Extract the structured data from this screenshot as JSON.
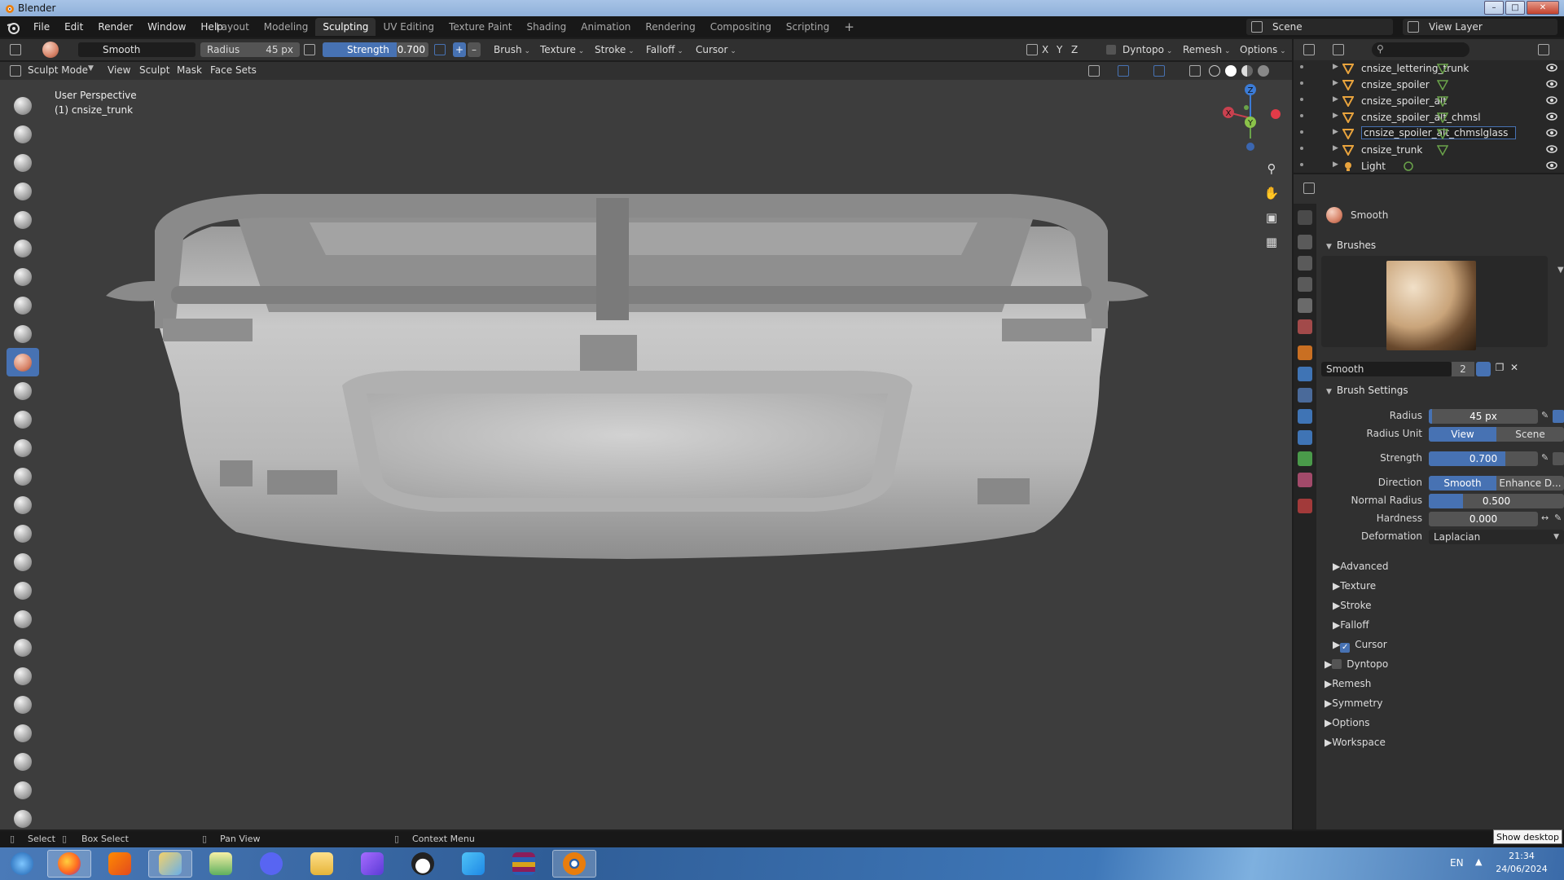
{
  "window": {
    "title": "Blender"
  },
  "menubar": {
    "menus": [
      "File",
      "Edit",
      "Render",
      "Window",
      "Help"
    ],
    "workspaces": [
      "Layout",
      "Modeling",
      "Sculpting",
      "UV Editing",
      "Texture Paint",
      "Shading",
      "Animation",
      "Rendering",
      "Compositing",
      "Scripting"
    ],
    "active_workspace": "Sculpting",
    "add_workspace": "+",
    "scene": "Scene",
    "view_layer": "View Layer"
  },
  "toolheader": {
    "brush_name": "Smooth",
    "radius_label": "Radius",
    "radius_value": "45 px",
    "strength_label": "Strength",
    "strength_value": "0.700",
    "strength_fraction": 0.7,
    "menus": [
      "Brush",
      "Texture",
      "Stroke",
      "Falloff",
      "Cursor"
    ],
    "axes": [
      "X",
      "Y",
      "Z"
    ],
    "dyntopo": "Dyntopo",
    "remesh": "Remesh",
    "options": "Options"
  },
  "modeheader": {
    "mode": "Sculpt Mode",
    "menus": [
      "View",
      "Sculpt",
      "Mask",
      "Face Sets"
    ]
  },
  "viewport": {
    "perspective": "User Perspective",
    "object": "(1) cnsize_trunk",
    "gizmo": {
      "z": "Z",
      "x": "X",
      "y": "Y"
    },
    "colors": {
      "background": "#3d3d3d",
      "model": "#b9b9b9",
      "accent": "#4772b3"
    }
  },
  "outliner": {
    "items": [
      {
        "name": "cnsize_lettering_trunk",
        "icon": "mesh-object-icon"
      },
      {
        "name": "cnsize_spoiler",
        "icon": "mesh-object-icon"
      },
      {
        "name": "cnsize_spoiler_alt",
        "icon": "mesh-object-icon"
      },
      {
        "name": "cnsize_spoiler_alt_chmsl",
        "icon": "mesh-object-icon"
      },
      {
        "name": "cnsize_spoiler_alt_chmslglass",
        "icon": "mesh-object-icon"
      },
      {
        "name": "cnsize_trunk",
        "icon": "mesh-object-icon"
      },
      {
        "name": "Light",
        "icon": "light-icon"
      }
    ]
  },
  "properties": {
    "brush_header": "Smooth",
    "brushes_section": "Brushes",
    "brush_field": "Smooth",
    "brush_users": "2",
    "brush_settings": "Brush Settings",
    "radius_label": "Radius",
    "radius_value": "45 px",
    "radius_unit_label": "Radius Unit",
    "radius_unit_options": [
      "View",
      "Scene"
    ],
    "strength_label": "Strength",
    "strength_value": "0.700",
    "strength_fraction": 0.7,
    "direction_label": "Direction",
    "direction_options": [
      "Smooth",
      "Enhance D..."
    ],
    "normal_radius_label": "Normal Radius",
    "normal_radius_value": "0.500",
    "normal_radius_fraction": 0.25,
    "hardness_label": "Hardness",
    "hardness_value": "0.000",
    "deformation_label": "Deformation",
    "deformation_value": "Laplacian",
    "subpanels": [
      "Advanced",
      "Texture",
      "Stroke",
      "Falloff",
      "Cursor"
    ],
    "cursor_checked": true,
    "panels": [
      "Dyntopo",
      "Remesh",
      "Symmetry",
      "Options",
      "Workspace"
    ],
    "dyntopo_checked": false
  },
  "statusbar": {
    "select": "Select",
    "box_select": "Box Select",
    "pan_view": "Pan View",
    "context_menu": "Context Menu",
    "show_desktop": "Show desktop"
  },
  "taskbar": {
    "apps": [
      "windows-start-icon",
      "firefox-icon",
      "app-orange-icon",
      "paint-icon",
      "notepad-icon",
      "discord-icon",
      "file-explorer-icon",
      "app-purple-icon",
      "tux-icon",
      "app-blue-icon",
      "archive-icon",
      "blender-icon"
    ],
    "lang": "EN",
    "time": "21:34",
    "date": "24/06/2024"
  }
}
